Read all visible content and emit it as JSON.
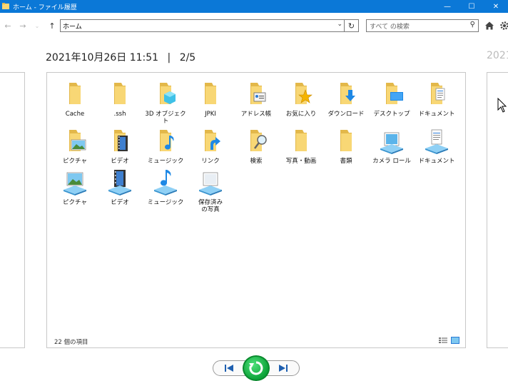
{
  "window": {
    "title": "ホーム - ファイル履歴",
    "minimize": "—",
    "maximize": "☐",
    "close": "✕"
  },
  "toolbar": {
    "back": "←",
    "forward": "→",
    "up": "↑",
    "address": "ホーム",
    "search_placeholder": "すべて の検索"
  },
  "header": {
    "datetime": "2021年10月26日 11:51",
    "separator": "|",
    "position": "2/5",
    "next_datetime": "2021"
  },
  "items": [
    {
      "label": "Cache",
      "icon": "folder"
    },
    {
      "label": ".ssh",
      "icon": "folder"
    },
    {
      "label": "3D オブジェクト",
      "icon": "folder-3d"
    },
    {
      "label": "JPKI",
      "icon": "folder"
    },
    {
      "label": "アドレス帳",
      "icon": "folder-contacts"
    },
    {
      "label": "お気に入り",
      "icon": "folder-favorites"
    },
    {
      "label": "ダウンロード",
      "icon": "folder-downloads"
    },
    {
      "label": "デスクトップ",
      "icon": "folder-desktop"
    },
    {
      "label": "ドキュメント",
      "icon": "folder-documents"
    },
    {
      "label": "ピクチャ",
      "icon": "folder-pictures"
    },
    {
      "label": "ビデオ",
      "icon": "folder-videos"
    },
    {
      "label": "ミュージック",
      "icon": "folder-music"
    },
    {
      "label": "リンク",
      "icon": "folder-links"
    },
    {
      "label": "検索",
      "icon": "folder-search"
    },
    {
      "label": "写真・動画",
      "icon": "folder"
    },
    {
      "label": "書類",
      "icon": "folder"
    },
    {
      "label": "カメラ ロール",
      "icon": "library-camera"
    },
    {
      "label": "ドキュメント",
      "icon": "library-documents"
    },
    {
      "label": "ピクチャ",
      "icon": "library-pictures"
    },
    {
      "label": "ビデオ",
      "icon": "library-videos"
    },
    {
      "label": "ミュージック",
      "icon": "library-music"
    },
    {
      "label": "保存済みの写真",
      "icon": "library-saved-pictures"
    }
  ],
  "status": {
    "count": "22 個の項目"
  },
  "colors": {
    "titlebar": "#0b78d7",
    "folder": "#f8d775",
    "folder_dark": "#e3b84a",
    "accent_blue": "#1e88e5",
    "restore_green": "#0ea43a"
  }
}
